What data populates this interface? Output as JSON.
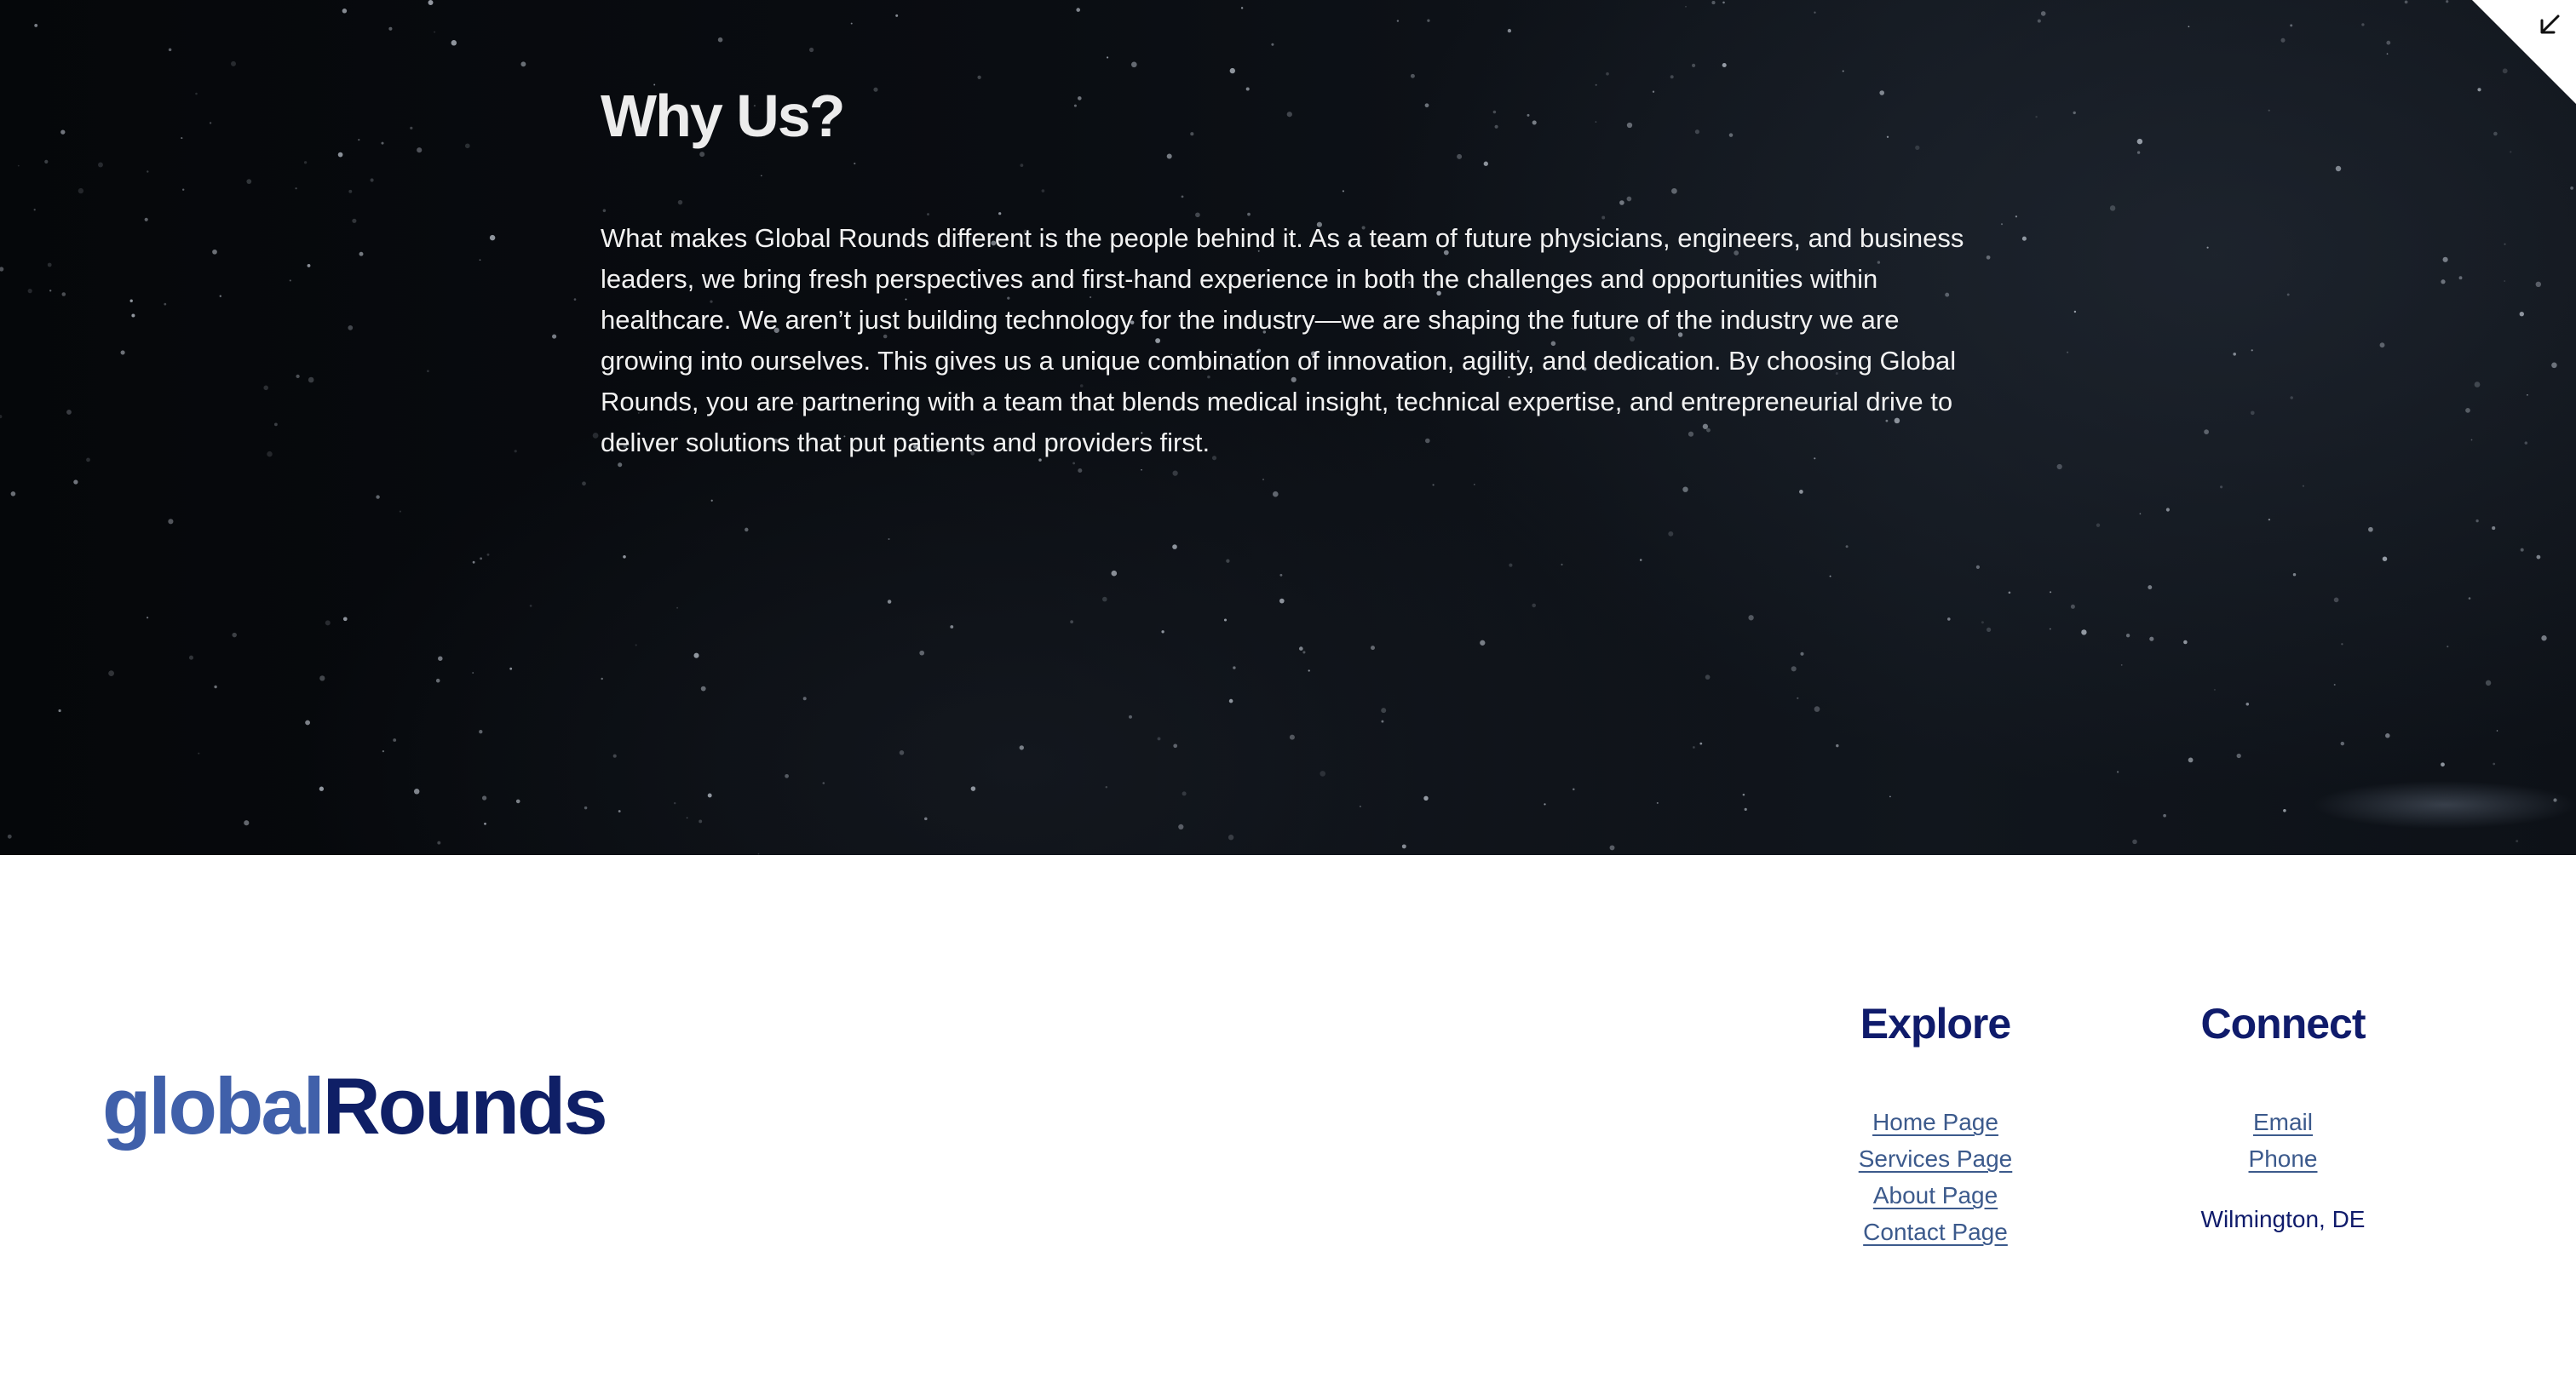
{
  "hero": {
    "title": "Why Us?",
    "body": "What makes Global Rounds different is the people behind it. As a team of future physicians, engineers, and business leaders, we bring fresh perspectives and first-hand experience in both the challenges and opportunities within healthcare. We aren’t just building technology for the industry—we are shaping the future of the industry we are growing into ourselves. This gives us a unique combination of innovation, agility, and dedication. By choosing Global Rounds, you are partnering with a team that blends medical insight, technical expertise, and entrepreneurial drive to deliver solutions that put patients and providers first.",
    "corner_icon": "arrow-down-left-icon"
  },
  "footer": {
    "logo_part1": "global",
    "logo_part2": "Rounds",
    "explore": {
      "heading": "Explore",
      "links": [
        "Home Page",
        "Services Page",
        "About Page",
        "Contact Page"
      ]
    },
    "connect": {
      "heading": "Connect",
      "links": [
        "Email",
        "Phone"
      ],
      "location": "Wilmington, DE"
    }
  },
  "colors": {
    "logo_light": "#4060aa",
    "logo_dark": "#0f1f66",
    "heading": "#0f1b6b",
    "link": "#3c5a8c",
    "hero_bg": "#0a0d12"
  }
}
